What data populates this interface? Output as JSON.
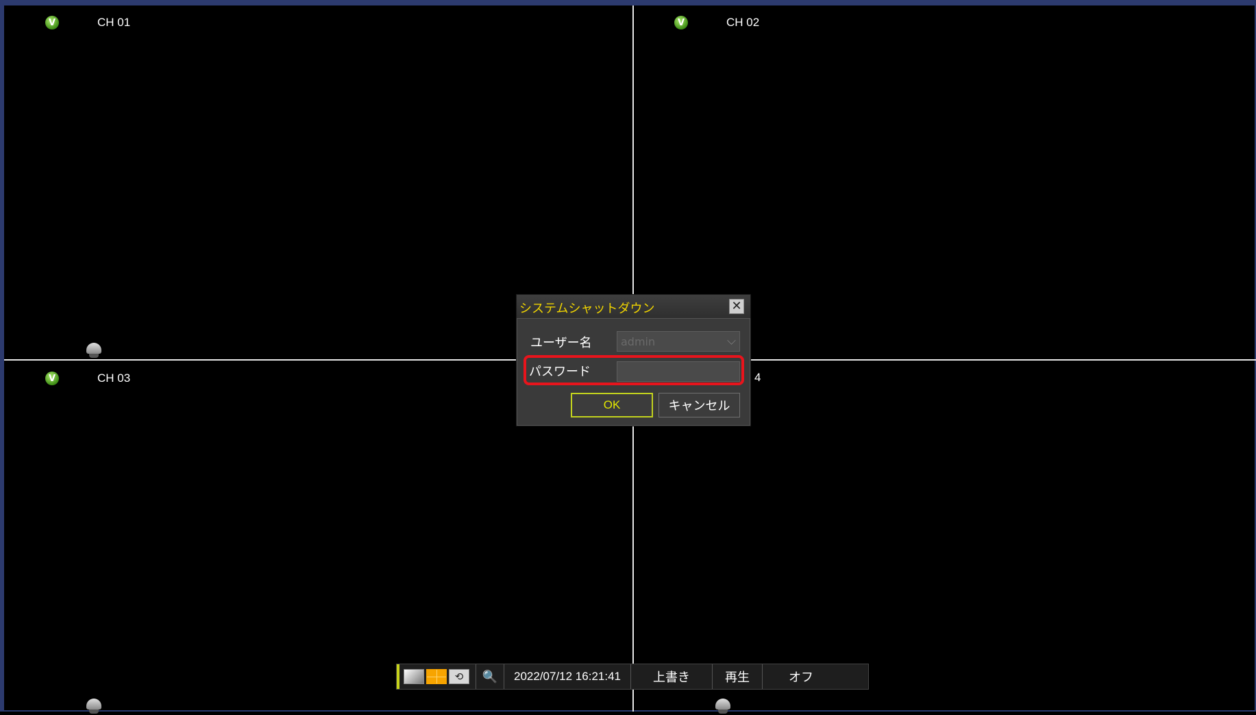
{
  "channels": [
    {
      "label": "CH 01",
      "status_icon": "v-icon"
    },
    {
      "label": "CH 02",
      "status_icon": "v-icon"
    },
    {
      "label": "CH 03",
      "status_icon": "v-icon"
    },
    {
      "label": "4",
      "status_icon": "v-icon"
    }
  ],
  "dialog": {
    "title": "システムシャットダウン",
    "close_icon": "close-icon",
    "username_label": "ユーザー名",
    "username_value": "admin",
    "password_label": "パスワード",
    "password_value": "",
    "ok_label": "OK",
    "cancel_label": "キャンセル"
  },
  "toolbar": {
    "icons": [
      "single-layout-icon",
      "quad-layout-icon",
      "rotate-icon",
      "zoom-icon"
    ],
    "zoom_glyph": "🔍",
    "rotate_glyph": "⟲",
    "datetime": "2022/07/12 16:21:41",
    "overwrite_label": "上書き",
    "playback_label": "再生",
    "off_label": "オフ"
  },
  "colors": {
    "title_yellow": "#f0d400",
    "highlight_red": "#e8141c",
    "ok_border": "#c2d21e",
    "status_green": "#3e8d15"
  }
}
